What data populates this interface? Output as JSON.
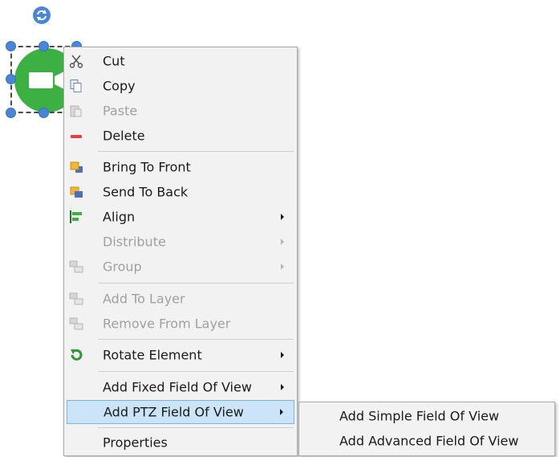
{
  "context_menu": {
    "items": [
      {
        "label": "Cut",
        "icon": "scissors-icon",
        "enabled": true
      },
      {
        "label": "Copy",
        "icon": "copy-icon",
        "enabled": true
      },
      {
        "label": "Paste",
        "icon": "paste-icon",
        "enabled": false
      },
      {
        "label": "Delete",
        "icon": "delete-icon",
        "enabled": true
      },
      {
        "label": "Bring To Front",
        "icon": "bring-to-front-icon",
        "enabled": true
      },
      {
        "label": "Send To Back",
        "icon": "send-to-back-icon",
        "enabled": true
      },
      {
        "label": "Align",
        "icon": "align-icon",
        "enabled": true,
        "has_submenu": true
      },
      {
        "label": "Distribute",
        "enabled": false,
        "has_submenu": true
      },
      {
        "label": "Group",
        "icon": "group-icon",
        "enabled": false,
        "has_submenu": true
      },
      {
        "label": "Add To Layer",
        "icon": "add-to-layer-icon",
        "enabled": false
      },
      {
        "label": "Remove From Layer",
        "icon": "remove-from-layer-icon",
        "enabled": false
      },
      {
        "label": "Rotate Element",
        "icon": "rotate-element-icon",
        "enabled": true,
        "has_submenu": true
      },
      {
        "label": "Add Fixed Field Of View",
        "enabled": true,
        "has_submenu": true
      },
      {
        "label": "Add PTZ Field Of View",
        "enabled": true,
        "has_submenu": true,
        "highlighted": true
      },
      {
        "label": "Properties",
        "enabled": true
      }
    ]
  },
  "submenu": {
    "parent": "Add PTZ Field Of View",
    "items": [
      {
        "label": "Add Simple Field Of View"
      },
      {
        "label": "Add Advanced Field Of View"
      }
    ]
  },
  "canvas": {
    "selected_element": "camera-node",
    "node_color": "#3cb043",
    "handle_color": "#4a86d8",
    "highlight_color": "#cce4f7"
  }
}
